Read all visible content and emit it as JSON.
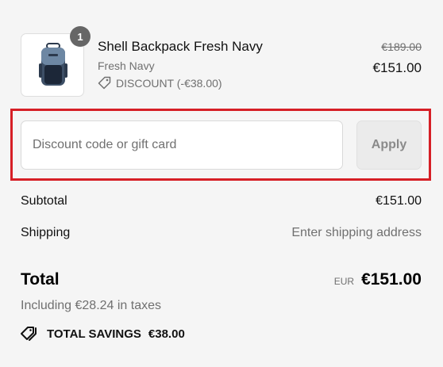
{
  "line_item": {
    "quantity": "1",
    "name": "Shell Backpack Fresh Navy",
    "variant": "Fresh Navy",
    "discount": "DISCOUNT (-€38.00)",
    "original_price": "€189.00",
    "price": "€151.00",
    "image_icon": "backpack-image"
  },
  "discount_form": {
    "placeholder": "Discount code or gift card",
    "apply_label": "Apply",
    "highlight_color": "#d61f26"
  },
  "summary": {
    "subtotal_label": "Subtotal",
    "subtotal_value": "€151.00",
    "shipping_label": "Shipping",
    "shipping_value": "Enter shipping address",
    "total_label": "Total",
    "currency": "EUR",
    "total_value": "€151.00",
    "tax_note": "Including €28.24 in taxes",
    "savings_label": "TOTAL SAVINGS",
    "savings_value": "€38.00"
  }
}
